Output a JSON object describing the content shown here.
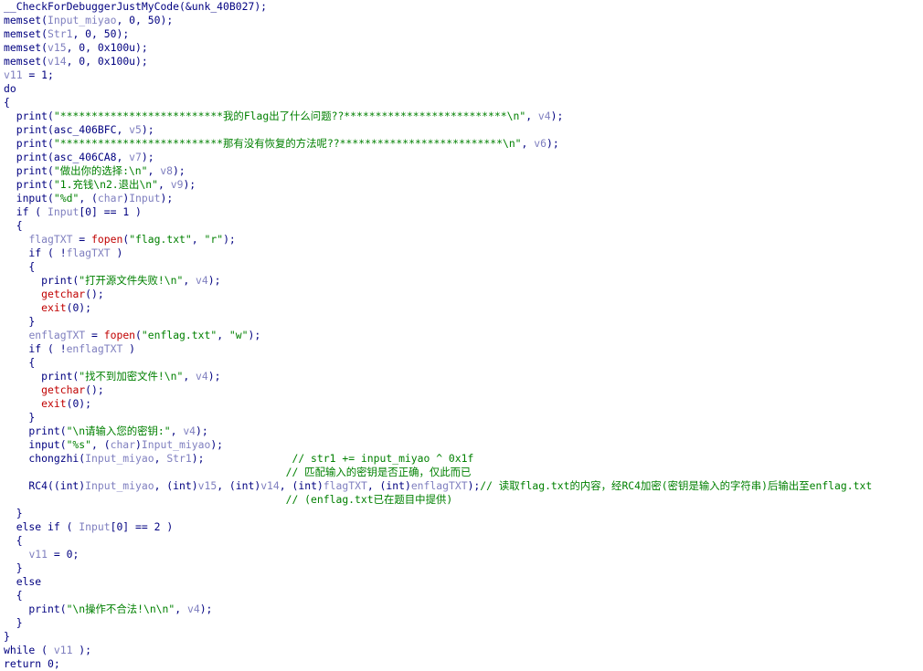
{
  "colors": {
    "background": "#ffffff",
    "keyword": "#000080",
    "variable": "#7f7fbf",
    "string": "#008000",
    "comment": "#008000",
    "library_call": "#c00000"
  },
  "code_lines": [
    [
      {
        "t": "__CheckForDebuggerJustMyCode",
        "k": "fn"
      },
      {
        "t": "(&",
        "k": "punc"
      },
      {
        "t": "unk_40B027",
        "k": "label"
      },
      {
        "t": ");",
        "k": "punc"
      }
    ],
    [
      {
        "t": "memset",
        "k": "fn"
      },
      {
        "t": "(",
        "k": "punc"
      },
      {
        "t": "Input_miyao",
        "k": "var"
      },
      {
        "t": ", 0, 50);",
        "k": "punc"
      }
    ],
    [
      {
        "t": "memset",
        "k": "fn"
      },
      {
        "t": "(",
        "k": "punc"
      },
      {
        "t": "Str1",
        "k": "var"
      },
      {
        "t": ", 0, 50);",
        "k": "punc"
      }
    ],
    [
      {
        "t": "memset",
        "k": "fn"
      },
      {
        "t": "(",
        "k": "punc"
      },
      {
        "t": "v15",
        "k": "var"
      },
      {
        "t": ", 0, 0x100u);",
        "k": "punc"
      }
    ],
    [
      {
        "t": "memset",
        "k": "fn"
      },
      {
        "t": "(",
        "k": "punc"
      },
      {
        "t": "v14",
        "k": "var"
      },
      {
        "t": ", 0, 0x100u);",
        "k": "punc"
      }
    ],
    [
      {
        "t": "v11",
        "k": "var"
      },
      {
        "t": " = 1;",
        "k": "punc"
      }
    ],
    [
      {
        "t": "do",
        "k": "kw"
      }
    ],
    [
      {
        "t": "{",
        "k": "punc"
      }
    ],
    [
      {
        "t": "  print(",
        "k": "fn"
      },
      {
        "t": "\"**************************我的Flag出了什么问题??**************************\\n\"",
        "k": "str"
      },
      {
        "t": ", ",
        "k": "punc"
      },
      {
        "t": "v4",
        "k": "var"
      },
      {
        "t": ");",
        "k": "punc"
      }
    ],
    [
      {
        "t": "  print(",
        "k": "fn"
      },
      {
        "t": "asc_406BFC",
        "k": "label"
      },
      {
        "t": ", ",
        "k": "punc"
      },
      {
        "t": "v5",
        "k": "var"
      },
      {
        "t": ");",
        "k": "punc"
      }
    ],
    [
      {
        "t": "  print(",
        "k": "fn"
      },
      {
        "t": "\"**************************那有没有恢复的方法呢??**************************\\n\"",
        "k": "str"
      },
      {
        "t": ", ",
        "k": "punc"
      },
      {
        "t": "v6",
        "k": "var"
      },
      {
        "t": ");",
        "k": "punc"
      }
    ],
    [
      {
        "t": "  print(",
        "k": "fn"
      },
      {
        "t": "asc_406CA8",
        "k": "label"
      },
      {
        "t": ", ",
        "k": "punc"
      },
      {
        "t": "v7",
        "k": "var"
      },
      {
        "t": ");",
        "k": "punc"
      }
    ],
    [
      {
        "t": "  print(",
        "k": "fn"
      },
      {
        "t": "\"做出你的选择:\\n\"",
        "k": "str"
      },
      {
        "t": ", ",
        "k": "punc"
      },
      {
        "t": "v8",
        "k": "var"
      },
      {
        "t": ");",
        "k": "punc"
      }
    ],
    [
      {
        "t": "  print(",
        "k": "fn"
      },
      {
        "t": "\"1.充钱\\n2.退出\\n\"",
        "k": "str"
      },
      {
        "t": ", ",
        "k": "punc"
      },
      {
        "t": "v9",
        "k": "var"
      },
      {
        "t": ");",
        "k": "punc"
      }
    ],
    [
      {
        "t": "  input(",
        "k": "fn"
      },
      {
        "t": "\"%d\"",
        "k": "str"
      },
      {
        "t": ", (",
        "k": "punc"
      },
      {
        "t": "char",
        "k": "var"
      },
      {
        "t": ")",
        "k": "punc"
      },
      {
        "t": "Input",
        "k": "var"
      },
      {
        "t": ");",
        "k": "punc"
      }
    ],
    [
      {
        "t": "  if ( ",
        "k": "kw"
      },
      {
        "t": "Input",
        "k": "var"
      },
      {
        "t": "[0] == 1 )",
        "k": "punc"
      }
    ],
    [
      {
        "t": "  {",
        "k": "punc"
      }
    ],
    [
      {
        "t": "    ",
        "k": "punc"
      },
      {
        "t": "flagTXT",
        "k": "var"
      },
      {
        "t": " = ",
        "k": "punc"
      },
      {
        "t": "fopen",
        "k": "call"
      },
      {
        "t": "(",
        "k": "punc"
      },
      {
        "t": "\"flag.txt\"",
        "k": "str"
      },
      {
        "t": ", ",
        "k": "punc"
      },
      {
        "t": "\"r\"",
        "k": "str"
      },
      {
        "t": ");",
        "k": "punc"
      }
    ],
    [
      {
        "t": "    if ( !",
        "k": "kw"
      },
      {
        "t": "flagTXT",
        "k": "var"
      },
      {
        "t": " )",
        "k": "punc"
      }
    ],
    [
      {
        "t": "    {",
        "k": "punc"
      }
    ],
    [
      {
        "t": "      print(",
        "k": "fn"
      },
      {
        "t": "\"打开源文件失败!\\n\"",
        "k": "str"
      },
      {
        "t": ", ",
        "k": "punc"
      },
      {
        "t": "v4",
        "k": "var"
      },
      {
        "t": ");",
        "k": "punc"
      }
    ],
    [
      {
        "t": "      ",
        "k": "punc"
      },
      {
        "t": "getchar",
        "k": "call"
      },
      {
        "t": "();",
        "k": "punc"
      }
    ],
    [
      {
        "t": "      ",
        "k": "punc"
      },
      {
        "t": "exit",
        "k": "call"
      },
      {
        "t": "(0);",
        "k": "punc"
      }
    ],
    [
      {
        "t": "    }",
        "k": "punc"
      }
    ],
    [
      {
        "t": "    ",
        "k": "punc"
      },
      {
        "t": "enflagTXT",
        "k": "var"
      },
      {
        "t": " = ",
        "k": "punc"
      },
      {
        "t": "fopen",
        "k": "call"
      },
      {
        "t": "(",
        "k": "punc"
      },
      {
        "t": "\"enflag.txt\"",
        "k": "str"
      },
      {
        "t": ", ",
        "k": "punc"
      },
      {
        "t": "\"w\"",
        "k": "str"
      },
      {
        "t": ");",
        "k": "punc"
      }
    ],
    [
      {
        "t": "    if ( !",
        "k": "kw"
      },
      {
        "t": "enflagTXT",
        "k": "var"
      },
      {
        "t": " )",
        "k": "punc"
      }
    ],
    [
      {
        "t": "    {",
        "k": "punc"
      }
    ],
    [
      {
        "t": "      print(",
        "k": "fn"
      },
      {
        "t": "\"找不到加密文件!\\n\"",
        "k": "str"
      },
      {
        "t": ", ",
        "k": "punc"
      },
      {
        "t": "v4",
        "k": "var"
      },
      {
        "t": ");",
        "k": "punc"
      }
    ],
    [
      {
        "t": "      ",
        "k": "punc"
      },
      {
        "t": "getchar",
        "k": "call"
      },
      {
        "t": "();",
        "k": "punc"
      }
    ],
    [
      {
        "t": "      ",
        "k": "punc"
      },
      {
        "t": "exit",
        "k": "call"
      },
      {
        "t": "(0);",
        "k": "punc"
      }
    ],
    [
      {
        "t": "    }",
        "k": "punc"
      }
    ],
    [
      {
        "t": "    print(",
        "k": "fn"
      },
      {
        "t": "\"\\n请输入您的密钥:\"",
        "k": "str"
      },
      {
        "t": ", ",
        "k": "punc"
      },
      {
        "t": "v4",
        "k": "var"
      },
      {
        "t": ");",
        "k": "punc"
      }
    ],
    [
      {
        "t": "    input(",
        "k": "fn"
      },
      {
        "t": "\"%s\"",
        "k": "str"
      },
      {
        "t": ", (",
        "k": "punc"
      },
      {
        "t": "char",
        "k": "var"
      },
      {
        "t": ")",
        "k": "punc"
      },
      {
        "t": "Input_miyao",
        "k": "var"
      },
      {
        "t": ");",
        "k": "punc"
      }
    ],
    [
      {
        "t": "    chongzhi(",
        "k": "fn"
      },
      {
        "t": "Input_miyao",
        "k": "var"
      },
      {
        "t": ", ",
        "k": "punc"
      },
      {
        "t": "Str1",
        "k": "var"
      },
      {
        "t": ");              ",
        "k": "punc"
      },
      {
        "t": "// str1 += input_miyao ^ 0x1f",
        "k": "cmt"
      }
    ],
    [
      {
        "t": "                                             ",
        "k": "punc"
      },
      {
        "t": "// 匹配输入的密钥是否正确，仅此而已",
        "k": "cmt"
      }
    ],
    [
      {
        "t": "    RC4((int)",
        "k": "fn"
      },
      {
        "t": "Input_miyao",
        "k": "var"
      },
      {
        "t": ", (int)",
        "k": "punc"
      },
      {
        "t": "v15",
        "k": "var"
      },
      {
        "t": ", (int)",
        "k": "punc"
      },
      {
        "t": "v14",
        "k": "var"
      },
      {
        "t": ", (int)",
        "k": "punc"
      },
      {
        "t": "flagTXT",
        "k": "var"
      },
      {
        "t": ", (int)",
        "k": "punc"
      },
      {
        "t": "enflagTXT",
        "k": "var"
      },
      {
        "t": ");",
        "k": "punc"
      },
      {
        "t": "// 读取flag.txt的内容，经RC4加密(密钥是输入的字符串)后输出至enflag.txt",
        "k": "cmt"
      }
    ],
    [
      {
        "t": "                                             ",
        "k": "punc"
      },
      {
        "t": "// (enflag.txt已在题目中提供)",
        "k": "cmt"
      }
    ],
    [
      {
        "t": "  }",
        "k": "punc"
      }
    ],
    [
      {
        "t": "  else if ( ",
        "k": "kw"
      },
      {
        "t": "Input",
        "k": "var"
      },
      {
        "t": "[0] == 2 )",
        "k": "punc"
      }
    ],
    [
      {
        "t": "  {",
        "k": "punc"
      }
    ],
    [
      {
        "t": "    ",
        "k": "punc"
      },
      {
        "t": "v11",
        "k": "var"
      },
      {
        "t": " = 0;",
        "k": "punc"
      }
    ],
    [
      {
        "t": "  }",
        "k": "punc"
      }
    ],
    [
      {
        "t": "  else",
        "k": "kw"
      }
    ],
    [
      {
        "t": "  {",
        "k": "punc"
      }
    ],
    [
      {
        "t": "    print(",
        "k": "fn"
      },
      {
        "t": "\"\\n操作不合法!\\n\\n\"",
        "k": "str"
      },
      {
        "t": ", ",
        "k": "punc"
      },
      {
        "t": "v4",
        "k": "var"
      },
      {
        "t": ");",
        "k": "punc"
      }
    ],
    [
      {
        "t": "  }",
        "k": "punc"
      }
    ],
    [
      {
        "t": "}",
        "k": "punc"
      }
    ],
    [
      {
        "t": "while ( ",
        "k": "kw"
      },
      {
        "t": "v11",
        "k": "var"
      },
      {
        "t": " );",
        "k": "punc"
      }
    ],
    [
      {
        "t": "return 0;",
        "k": "kw"
      }
    ]
  ]
}
